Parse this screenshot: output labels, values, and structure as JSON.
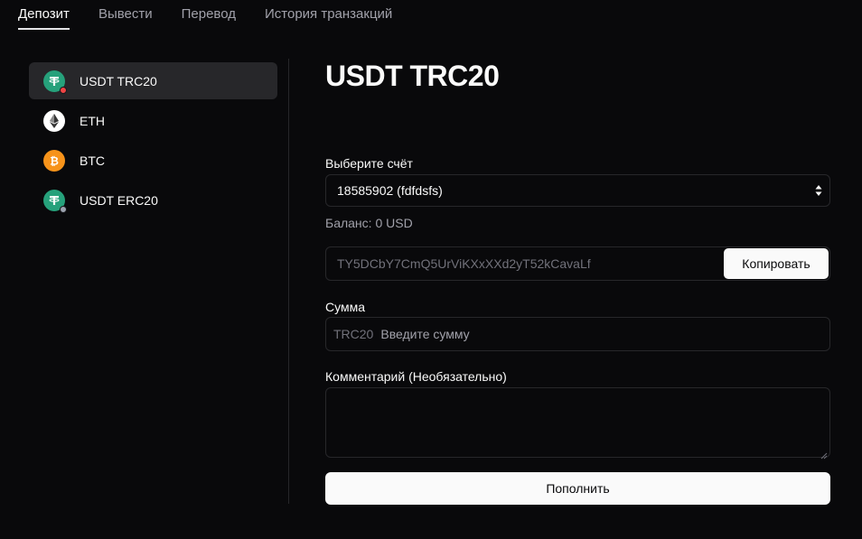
{
  "tabs": [
    {
      "label": "Депозит",
      "active": true
    },
    {
      "label": "Вывести",
      "active": false
    },
    {
      "label": "Перевод",
      "active": false
    },
    {
      "label": "История транзакций",
      "active": false
    }
  ],
  "sidebar": {
    "items": [
      {
        "label": "USDT TRC20",
        "icon": "tether-icon",
        "active": true
      },
      {
        "label": "ETH",
        "icon": "ethereum-icon",
        "active": false
      },
      {
        "label": "BTC",
        "icon": "bitcoin-icon",
        "active": false
      },
      {
        "label": "USDT ERC20",
        "icon": "tether-icon",
        "active": false
      }
    ]
  },
  "main": {
    "title": "USDT TRC20",
    "account_label": "Выберите счёт",
    "account_value": "18585902 (fdfdsfs)",
    "balance": "Баланс: 0 USD",
    "address": "TY5DCbY7CmQ5UrViKXxXXd2yT52kCavaLf",
    "copy_label": "Копировать",
    "amount_label": "Сумма",
    "amount_prefix": "TRC20",
    "amount_placeholder": "Введите сумму",
    "comment_label": "Комментарий (Необязательно)",
    "comment_value": "",
    "submit_label": "Пополнить"
  },
  "colors": {
    "background": "#09090b",
    "surface_active": "#27272a",
    "border": "#27272a",
    "primary_button": "#fafafa",
    "tether": "#26a17b",
    "bitcoin": "#f7931a",
    "badge_red": "#ef4444"
  }
}
